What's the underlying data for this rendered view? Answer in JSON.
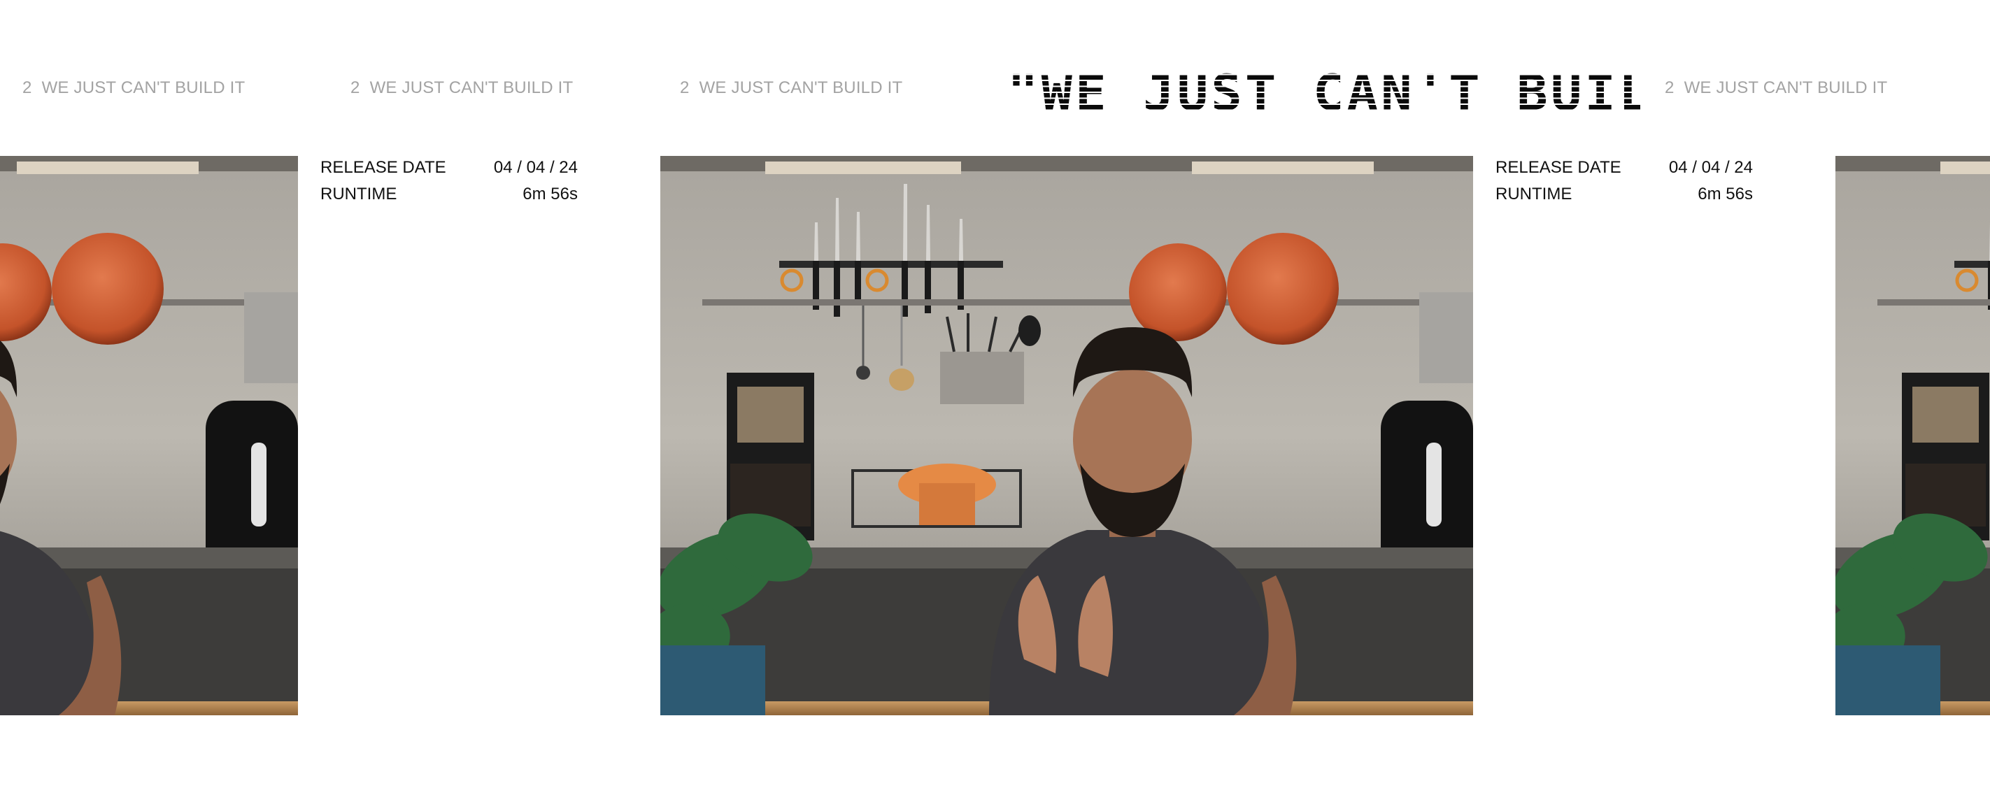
{
  "ticker": {
    "items": [
      {
        "number": "2",
        "title": "WE JUST CAN'T BUILD IT"
      },
      {
        "number": "2",
        "title": "WE JUST CAN'T BUILD IT"
      },
      {
        "number": "2",
        "title": "WE JUST CAN'T BUILD IT"
      },
      {
        "number": "2",
        "title": "WE JUST CAN'T BUILD IT"
      }
    ]
  },
  "hero": {
    "title": "\"WE JUST CAN'T BUILD IT\""
  },
  "meta": [
    {
      "release_label": "RELEASE DATE",
      "release_value": "04 / 04 / 24",
      "runtime_label": "RUNTIME",
      "runtime_value": "6m 56s"
    },
    {
      "release_label": "RELEASE DATE",
      "release_value": "04 / 04 / 24",
      "runtime_label": "RUNTIME",
      "runtime_value": "6m 56s"
    }
  ],
  "colors": {
    "ticker_text": "#a3a3a3",
    "title_text": "#0a0a0a",
    "meta_text": "#111111",
    "background": "#ffffff"
  }
}
